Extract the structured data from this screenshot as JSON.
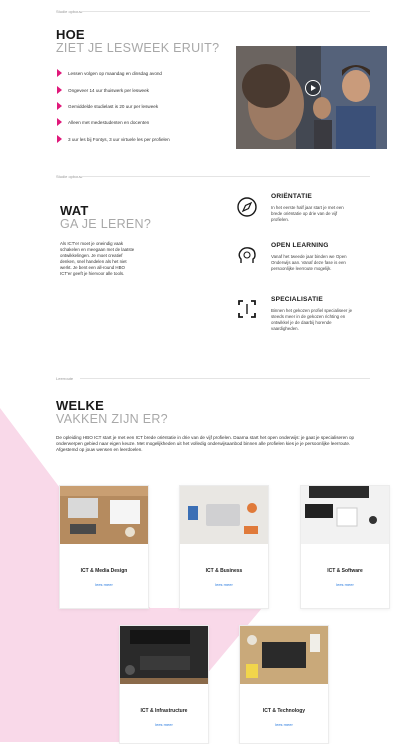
{
  "section1": {
    "label": "Studie opbouw",
    "heading_dark": "HOE",
    "heading_light": "ZIET JE LESWEEK ERUIT?",
    "bullets": [
      "Lessen volgen op maandag en dinsdag avond",
      "Ongeveer 14 uur thuiswerk per lesweek",
      "Gemiddelde studielast is 20 uur per lesweek",
      "Alleen met medestudenten en docenten",
      "3 uur les bij Fontys, 3 uur virtuele les per profielen"
    ],
    "video_icon": "play-icon"
  },
  "section2": {
    "label": "Studie opbouw",
    "heading_dark": "WAT",
    "heading_light": "GA JE LEREN?",
    "body": "Als ICT'er moet je oneindig vaak schakelen en meegaan met de laatste ontwikkelingen. Je moet creatief denken, snel handelen als het niet werkt. Je bent een all-round HBO ICT'er geeft je hiervoor alle tools.",
    "features": [
      {
        "title": "ORIËNTATIE",
        "desc": "In het eerste half jaar start je met een brede oriëntatie op drie van de vijf profielen.",
        "icon": "compass-icon"
      },
      {
        "title": "OPEN LEARNING",
        "desc": "Vanaf het tweede jaar binden we Open Onderwijs aan. Vanaf deze fase is een persoonlijke leerroute mogelijk.",
        "icon": "brain-icon"
      },
      {
        "title": "SPECIALISATIE",
        "desc": "Binnen het gekozen profiel specialiseer je steeds meer in de gekozen richting en ontwikkel je de daarbij horende vaardigheden.",
        "icon": "focus-icon"
      }
    ]
  },
  "section3": {
    "label": "Leerroute",
    "heading_dark": "WELKE",
    "heading_light": "VAKKEN ZIJN ER?",
    "intro": "De opleiding HBO ICT start je met een ICT brede oriëntatie in drie van de vijf profielen. Daarna start het open onderwijs: je gaat je specialiseren op onderwerpen gebied naar eigen keuze. Met mogelijkheden uit het volledig onderwijsaanbod binnen alle profielen kies je je persoonlijke leerroute. Afgestemd op jouw wensen en leerdoelen.",
    "cards": [
      {
        "title": "ICT & Media Design",
        "link": "lees meer"
      },
      {
        "title": "ICT & Business",
        "link": "lees meer"
      },
      {
        "title": "ICT & Software",
        "link": "lees meer"
      },
      {
        "title": "ICT & Infrastructure",
        "link": "lees meer"
      },
      {
        "title": "ICT & Technology",
        "link": "lees meer"
      }
    ]
  },
  "colors": {
    "accent": "#e0187a",
    "pink_bg": "#f9d9e9",
    "link": "#2a7bde",
    "light_heading": "#a8a8a8"
  }
}
